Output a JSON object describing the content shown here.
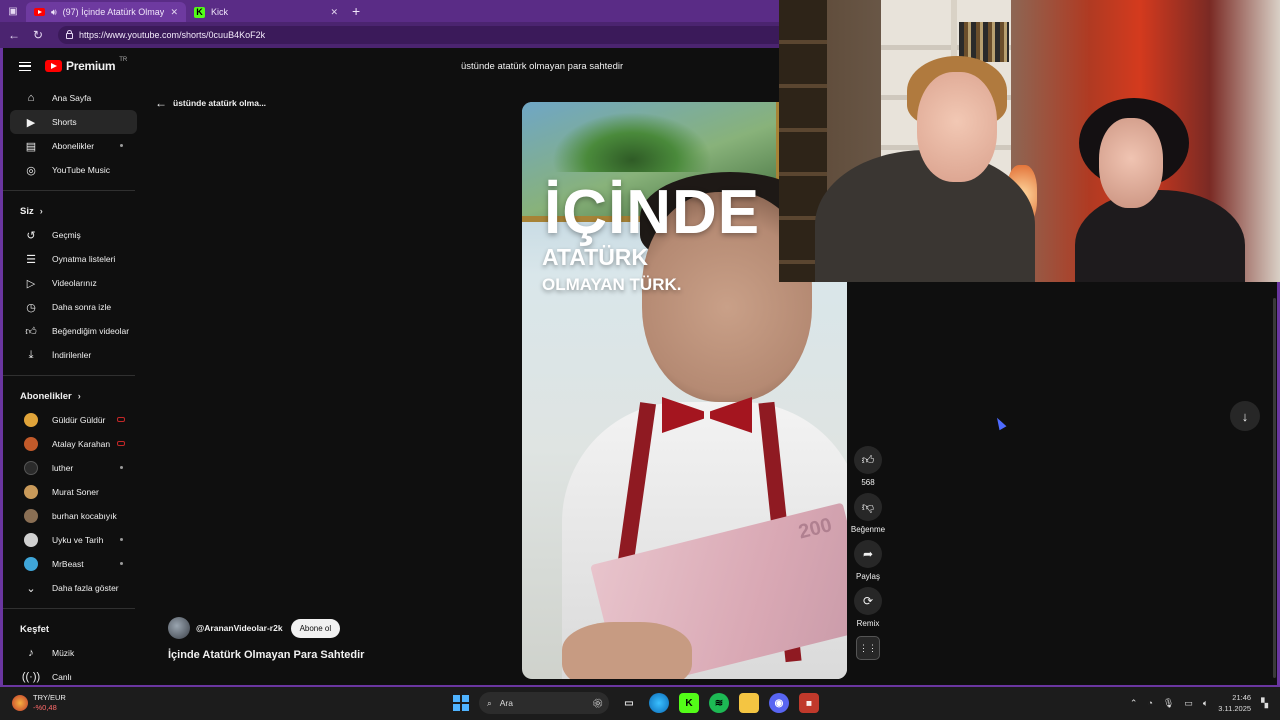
{
  "browser": {
    "tabs": [
      {
        "title": "(97) İçinde Atatürk Olmayan...",
        "icon": "youtube-icon",
        "active": true
      },
      {
        "title": "Kick",
        "icon": "kick-icon",
        "active": false
      }
    ],
    "new_tab": "+",
    "url": "https://www.youtube.com/shorts/0cuuB4KoF2k"
  },
  "header": {
    "logo": "Premium",
    "logo_region": "TR",
    "search_value": "üstünde atatürk olmayan para sahtedir"
  },
  "sidebar": {
    "main": [
      {
        "label": "Ana Sayfa",
        "icon": "home-icon"
      },
      {
        "label": "Shorts",
        "icon": "shorts-icon",
        "active": true
      },
      {
        "label": "Abonelikler",
        "icon": "subscriptions-icon",
        "dot": true
      },
      {
        "label": "YouTube Music",
        "icon": "music-icon"
      }
    ],
    "you_heading": "Siz",
    "you": [
      {
        "label": "Geçmiş",
        "icon": "history-icon"
      },
      {
        "label": "Oynatma listeleri",
        "icon": "playlists-icon"
      },
      {
        "label": "Videolarınız",
        "icon": "your-videos-icon"
      },
      {
        "label": "Daha sonra izle",
        "icon": "watch-later-icon"
      },
      {
        "label": "Beğendiğim videolar",
        "icon": "liked-icon"
      },
      {
        "label": "İndirilenler",
        "icon": "downloads-icon"
      }
    ],
    "subs_heading": "Abonelikler",
    "subs": [
      {
        "label": "Güldür Güldür",
        "color": "#e0a43a",
        "badge": "live"
      },
      {
        "label": "Atalay Karahan",
        "color": "#c25a2a",
        "badge": "live"
      },
      {
        "label": "luther",
        "color": "#2b2b2b",
        "badge": "dot"
      },
      {
        "label": "Murat Soner",
        "color": "#c99a5a",
        "badge": ""
      },
      {
        "label": "burhan kocabıyık",
        "color": "#8a6f54",
        "badge": ""
      },
      {
        "label": "Uyku ve Tarih",
        "color": "#d0d0d0",
        "badge": "dot"
      },
      {
        "label": "MrBeast",
        "color": "#3fa6d9",
        "badge": "dot"
      }
    ],
    "show_more": "Daha fazla göster",
    "explore_heading": "Keşfet",
    "explore": [
      {
        "label": "Müzik",
        "icon": "music-note-icon"
      },
      {
        "label": "Canlı",
        "icon": "live-icon"
      }
    ]
  },
  "shorts": {
    "back_label": "üstünde atatürk olma...",
    "channel": "@ArananVideolar-r2k",
    "subscribe": "Abone ol",
    "title": "İçinde Atatürk Olmayan Para Sahtedir",
    "overlay_big": "İÇİNDE",
    "overlay_mid": "ATATÜRK",
    "overlay_small": "OLMAYAN TÜRK.",
    "note_number": "200",
    "actions": {
      "like_count": "568",
      "dislike": "Beğenme",
      "share": "Paylaş",
      "remix": "Remix"
    }
  },
  "taskbar": {
    "currency": "TRY/EUR",
    "currency_change": "-%0,48",
    "search": "Ara",
    "time": "21:46",
    "date": "3.11.2025"
  },
  "colors": {
    "chrome": "#5a2c86",
    "yt_bg": "#0f0f0f",
    "yt_red": "#ff0000"
  }
}
